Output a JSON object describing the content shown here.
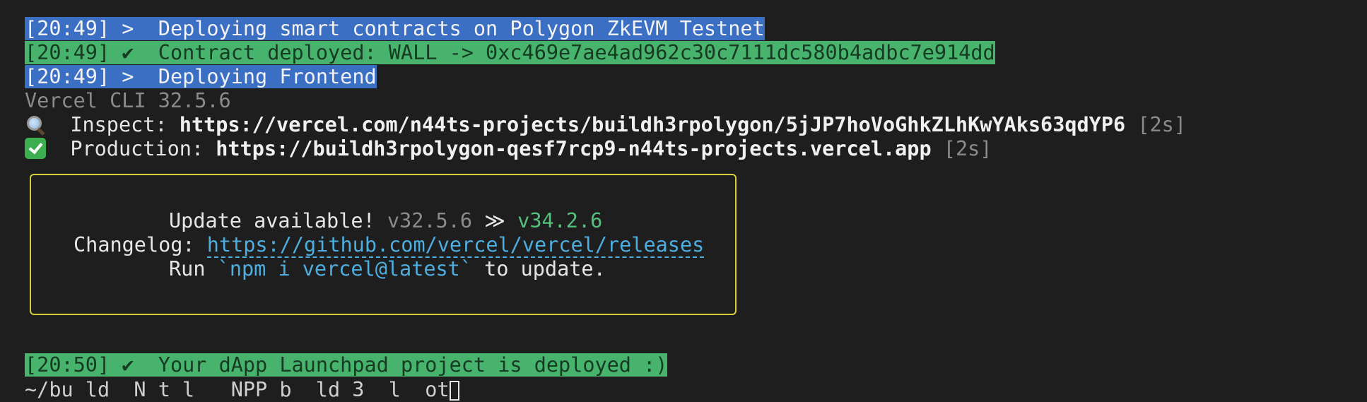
{
  "log": {
    "line1": {
      "time": "[20:49]",
      "symbol": ">",
      "text": "Deploying smart contracts on Polygon ZkEVM Testnet"
    },
    "line2": {
      "time": "[20:49]",
      "symbol": "✔",
      "text": "Contract deployed: WALL -> 0xc469e7ae4ad962c30c7111dc580b4adbc7e914dd"
    },
    "line3": {
      "time": "[20:49]",
      "symbol": ">",
      "text": "Deploying Frontend"
    },
    "line4": {
      "text": "Vercel CLI 32.5.6"
    },
    "inspect": {
      "icon": "magnifying-glass-icon",
      "label": "Inspect:",
      "url": "https://vercel.com/n44ts-projects/buildh3rpolygon/5jJP7hoVoGhkZLhKwYAks63qdYP6",
      "duration": "[2s]"
    },
    "production": {
      "icon": "check-mark-button-icon",
      "label": "Production:",
      "url": "https://buildh3rpolygon-qesf7rcp9-n44ts-projects.vercel.app",
      "duration": "[2s]"
    }
  },
  "update_box": {
    "title": "Update available!",
    "current_version": "v32.5.6",
    "arrow": "≫",
    "new_version": "v34.2.6",
    "changelog_label": "Changelog:",
    "changelog_url": "https://github.com/vercel/vercel/releases",
    "run_label": "Run",
    "command": "`npm i vercel@latest`",
    "run_suffix": "to update."
  },
  "final": {
    "time": "[20:50]",
    "symbol": "✔",
    "text": "Your dApp Launchpad project is deployed :)"
  },
  "prompt": {
    "text": "~/bu ld  N t l   NPP b  ld 3  l  ot"
  },
  "colors": {
    "background": "#1e1e1e",
    "highlight_blue": "#3a6fc4",
    "highlight_green": "#47b36c",
    "box_border": "#d7cf3a",
    "link": "#4eaee0"
  }
}
